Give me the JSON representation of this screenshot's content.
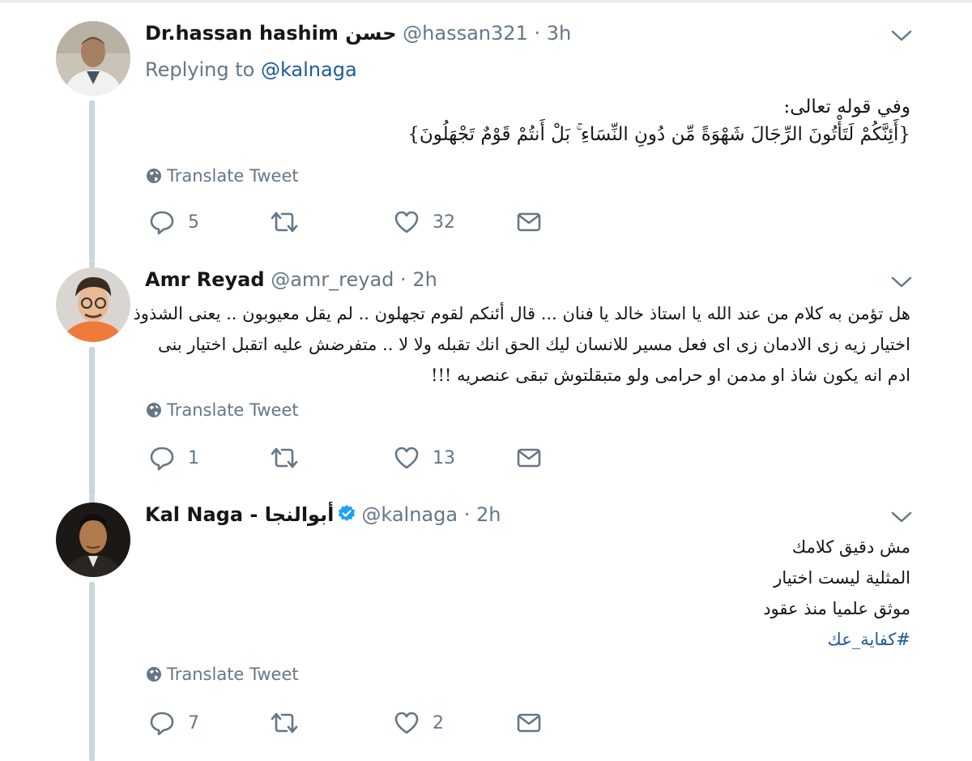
{
  "tweets": [
    {
      "display_name": "Dr.hassan hashim حسن",
      "handle": "@hassan321",
      "separator": "·",
      "time": "3h",
      "replying_prefix": "Replying to",
      "replying_mention": "@kalnaga",
      "body_lines": [
        "وفي قوله تعالى:",
        "{أَئِنَّكُمْ لَتَأْتُونَ الرِّجَالَ شَهْوَةً مِّن دُونِ النِّسَاءِ ۚ بَلْ أَنتُمْ قَوْمٌ تَجْهَلُونَ}"
      ],
      "translate_label": "Translate Tweet",
      "reply_count": "5",
      "retweet_count": "",
      "like_count": "32"
    },
    {
      "display_name": "Amr Reyad",
      "handle": "@amr_reyad",
      "separator": "·",
      "time": "2h",
      "body_lines": [
        "هل تؤمن به كلام من عند الله يا استاذ خالد يا فنان ... قال أئنكم لقوم تجهلون .. لم يقل معيوبون .. يعنى الشذوذ",
        "اختيار زيه زى الادمان زى اى فعل مسير للانسان ليك الحق انك تقبله ولا لا .. متفرضش عليه اتقبل اختيار بنى",
        "ادم انه يكون شاذ او مدمن او حرامى ولو متبقلتوش تبقى عنصريه !!!"
      ],
      "translate_label": "Translate Tweet",
      "reply_count": "1",
      "retweet_count": "",
      "like_count": "13"
    },
    {
      "display_name": "Kal Naga - أبوالنجا",
      "handle": "@kalnaga",
      "separator": "·",
      "time": "2h",
      "verified": true,
      "body_lines": [
        "مش دقيق كلامك",
        "المثلية ليست اختيار",
        "موثق علميا منذ عقود"
      ],
      "hashtag": "#كفاية_عك",
      "translate_label": "Translate Tweet",
      "reply_count": "7",
      "retweet_count": "",
      "like_count": "2"
    }
  ],
  "colors": {
    "link": "#1b5b9a",
    "muted": "#657786",
    "thread_line": "#ccd6dd",
    "verified": "#1da1f2"
  },
  "icons": [
    "chevron-down-icon",
    "globe-icon",
    "reply-icon",
    "retweet-icon",
    "like-icon",
    "message-icon",
    "verified-icon"
  ]
}
